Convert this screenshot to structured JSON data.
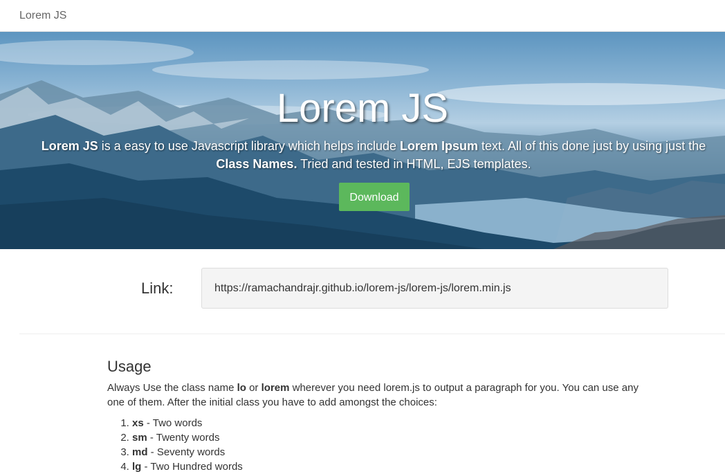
{
  "navbar": {
    "brand": "Lorem JS"
  },
  "hero": {
    "title": "Lorem JS",
    "desc_part1": "Lorem JS",
    "desc_part2": " is a easy to use Javascript library which helps include ",
    "desc_part3": "Lorem Ipsum",
    "desc_part4": " text. All of this done just by using just the ",
    "desc_part5": "Class Names.",
    "desc_part6": " Tried and tested in HTML, EJS templates.",
    "download_label": "Download",
    "download_color": "#5cb85c"
  },
  "link": {
    "label": "Link:",
    "url": "https://ramachandrajr.github.io/lorem-js/lorem-js/lorem.min.js"
  },
  "usage": {
    "title": "Usage",
    "text_part1": "Always Use the class name ",
    "text_part2": "lo",
    "text_part3": " or ",
    "text_part4": "lorem",
    "text_part5": " wherever you need lorem.js to output a paragraph for you. You can use any one of them. After the initial class you have to add amongst the choices:",
    "choices": [
      {
        "key": "xs",
        "desc": " - Two words"
      },
      {
        "key": "sm",
        "desc": " - Twenty words"
      },
      {
        "key": "md",
        "desc": " - Seventy words"
      },
      {
        "key": "lg",
        "desc": " - Two Hundred words"
      }
    ]
  }
}
